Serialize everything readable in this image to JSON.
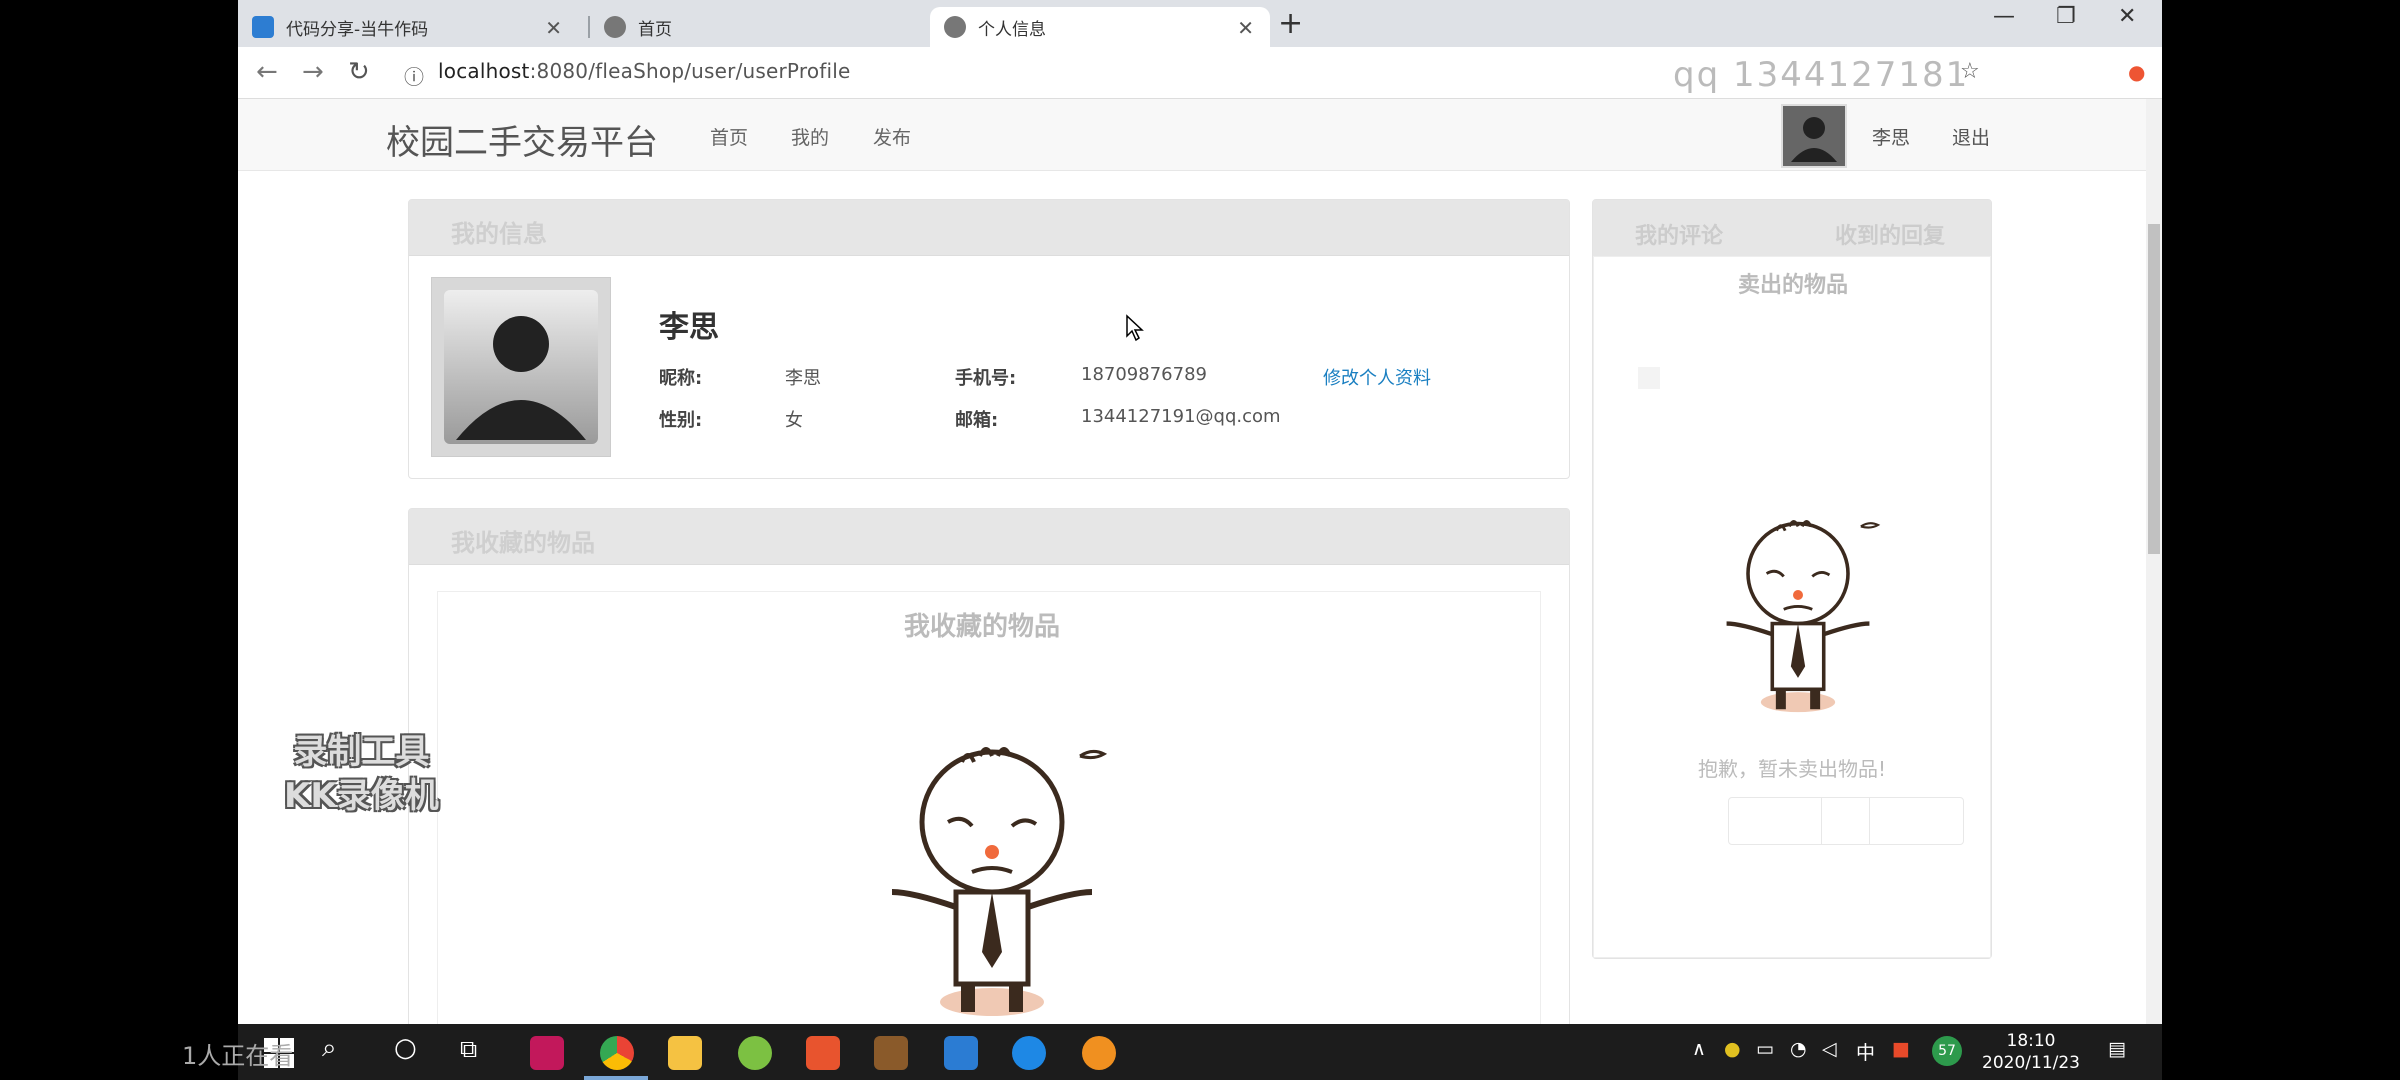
{
  "browser": {
    "tabs": [
      {
        "title": "代码分享-当牛作码",
        "favicon": "dnzm-favicon"
      },
      {
        "title": "首页",
        "favicon": "globe-icon"
      },
      {
        "title": "个人信息",
        "favicon": "globe-icon"
      }
    ],
    "url_host": "localhost",
    "url_rest": ":8080/fleaShop/user/userProfile",
    "watermark": "qq 1344127181"
  },
  "site": {
    "brand": "校园二手交易平台",
    "nav": [
      "首页",
      "我的",
      "发布"
    ],
    "user": "李思",
    "logout": "退出"
  },
  "profile": {
    "panel_title": "我的信息",
    "name": "李思",
    "nickname_label": "昵称:",
    "nickname": "李思",
    "phone_label": "手机号:",
    "phone": "18709876789",
    "edit_link": "修改个人资料",
    "gender_label": "性别:",
    "gender": "女",
    "email_label": "邮箱:",
    "email": "1344127191@qq.com"
  },
  "favorites": {
    "panel_title": "我收藏的物品",
    "inner_title": "我收藏的物品"
  },
  "sidebar": {
    "tabs": [
      "我的评论",
      "收到的回复"
    ],
    "sold_title": "卖出的物品",
    "empty_text": "抱歉，暂未卖出物品!"
  },
  "overlay": {
    "line1": "录制工具",
    "line2": "KK录像机",
    "people": "1人正在看"
  },
  "taskbar": {
    "time": "18:10",
    "date": "2020/11/23",
    "ime": "中",
    "badge": "57"
  }
}
